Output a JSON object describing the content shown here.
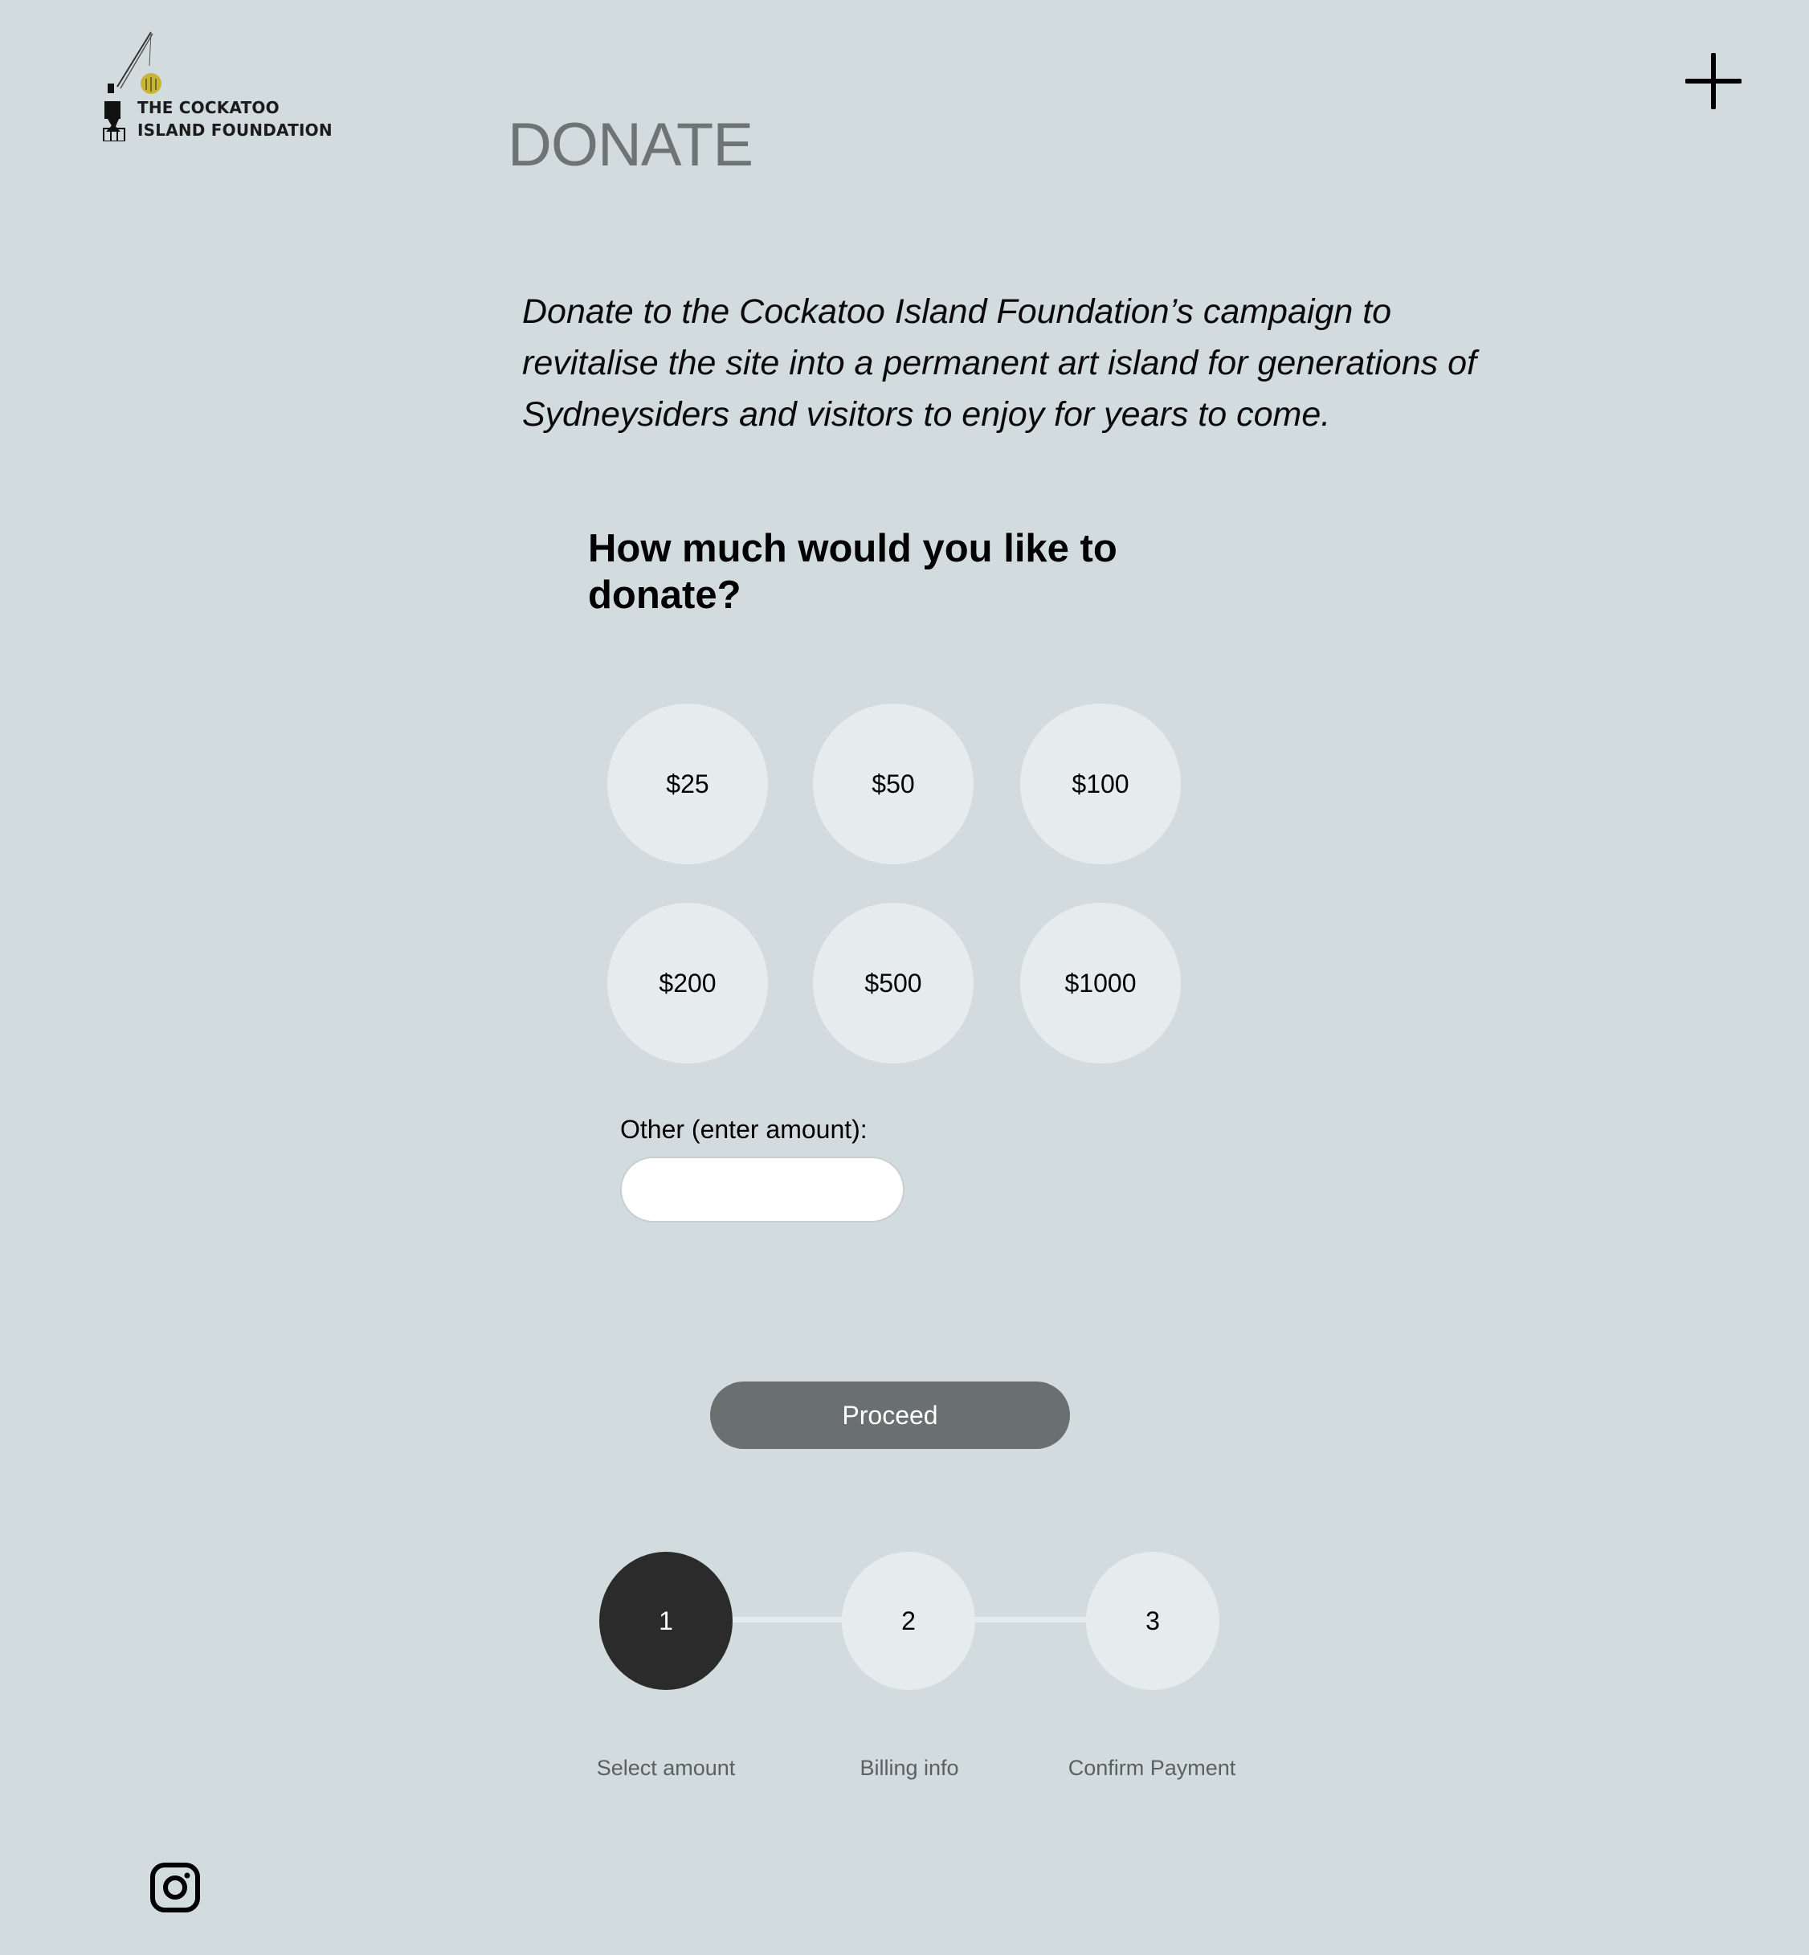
{
  "logo": {
    "line1": "THE COCKATOO",
    "line2": "ISLAND FOUNDATION"
  },
  "header": {
    "title": "DONATE",
    "menu_icon": "plus-icon"
  },
  "intro": {
    "text": "Donate to the Cockatoo Island Foundation’s campaign to revitalise the site into a permanent art island for generations of Sydneysiders and visitors to enjoy for years to come."
  },
  "donation": {
    "question": "How much would you like to donate?",
    "amounts": [
      "$25",
      "$50",
      "$100",
      "$200",
      "$500",
      "$1000"
    ],
    "other_label": "Other (enter amount):",
    "other_value": "",
    "proceed_label": "Proceed"
  },
  "steps": [
    {
      "number": "1",
      "label": "Select amount",
      "active": true
    },
    {
      "number": "2",
      "label": "Billing info",
      "active": false
    },
    {
      "number": "3",
      "label": "Confirm Payment",
      "active": false
    }
  ],
  "footer": {
    "social_icon": "instagram-icon"
  },
  "colors": {
    "background": "#d2dcde",
    "circle": "#e6ecee",
    "active_step": "#2a2b2a",
    "proceed": "#6a6f70",
    "title": "#6e7374",
    "logo_accent": "#c9b43a"
  }
}
